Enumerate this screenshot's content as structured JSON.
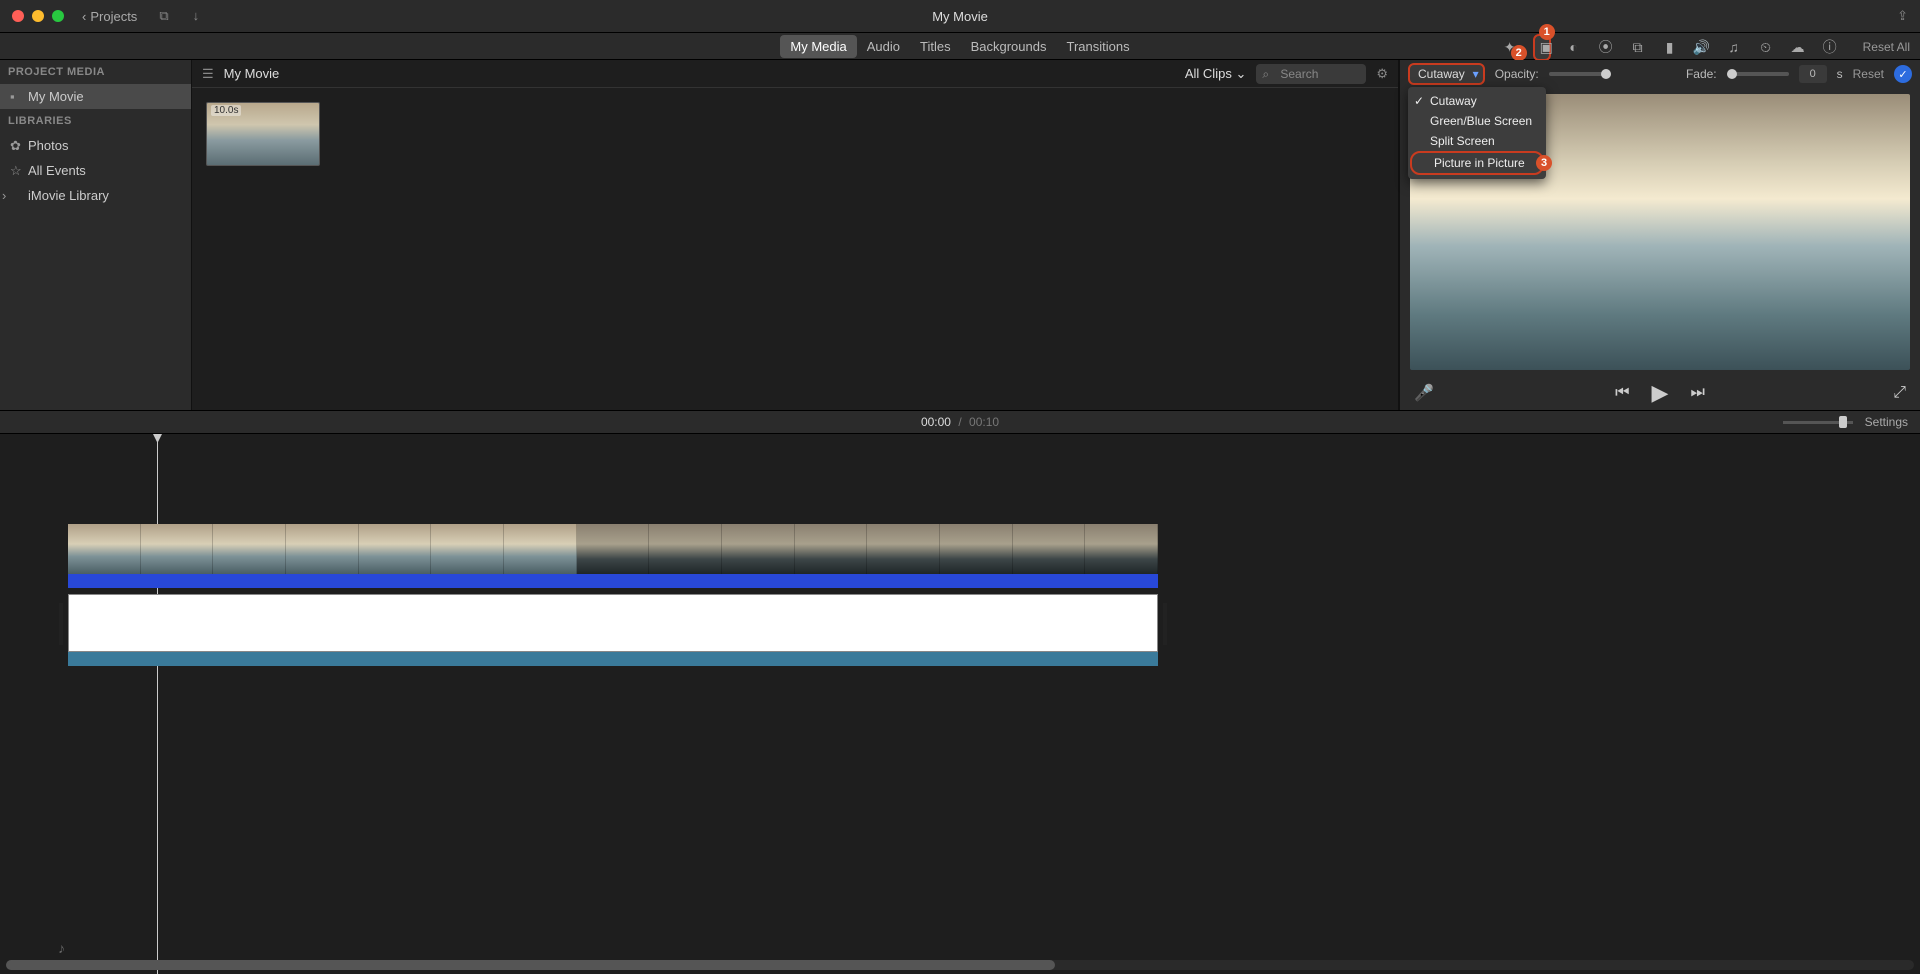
{
  "titlebar": {
    "back_label": "Projects",
    "title": "My Movie"
  },
  "tabs": {
    "my_media": "My Media",
    "audio": "Audio",
    "titles": "Titles",
    "backgrounds": "Backgrounds",
    "transitions": "Transitions"
  },
  "adjust": {
    "reset_all": "Reset All",
    "badges": {
      "b1": "1",
      "b2": "2",
      "b3": "3"
    },
    "icons": {
      "wand": "magic-wand",
      "overlay": "overlay",
      "color-balance": "color-balance",
      "color-wheel": "color-correction",
      "crop": "crop",
      "stabilize": "stabilization",
      "volume": "volume",
      "noise": "noise-reduction",
      "speed": "speed",
      "filter": "clip-filter",
      "info": "info"
    }
  },
  "sidebar": {
    "section1": "PROJECT MEDIA",
    "item_mymovie": "My Movie",
    "section2": "LIBRARIES",
    "item_photos": "Photos",
    "item_allevents": "All Events",
    "item_library": "iMovie Library"
  },
  "browser": {
    "breadcrumb": "My Movie",
    "all_clips": "All Clips",
    "search_placeholder": "Search",
    "thumb_duration": "10.0s"
  },
  "overlay_controls": {
    "dropdown_label": "Cutaway",
    "menu": {
      "cutaway": "Cutaway",
      "greenblue": "Green/Blue Screen",
      "split": "Split Screen",
      "pip": "Picture in Picture"
    },
    "opacity_label": "Opacity:",
    "fade_label": "Fade:",
    "fade_value": "0",
    "fade_unit": "s",
    "reset": "Reset"
  },
  "timeline": {
    "current": "00:00",
    "sep": "/",
    "total": "00:10",
    "settings": "Settings"
  }
}
